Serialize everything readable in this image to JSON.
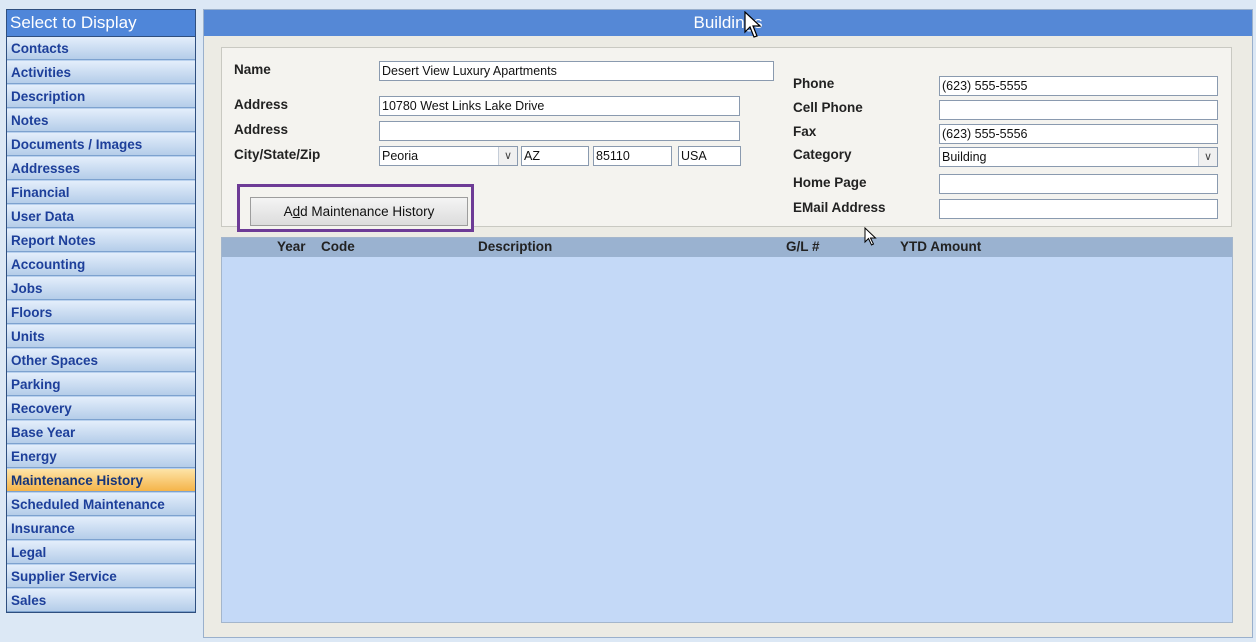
{
  "sidebar": {
    "title": "Select to Display",
    "items": [
      {
        "label": "Contacts"
      },
      {
        "label": "Activities"
      },
      {
        "label": "Description"
      },
      {
        "label": "Notes"
      },
      {
        "label": "Documents / Images"
      },
      {
        "label": "Addresses"
      },
      {
        "label": "Financial"
      },
      {
        "label": "User Data"
      },
      {
        "label": "Report Notes"
      },
      {
        "label": "Accounting"
      },
      {
        "label": "Jobs"
      },
      {
        "label": "Floors"
      },
      {
        "label": "Units"
      },
      {
        "label": "Other Spaces"
      },
      {
        "label": "Parking"
      },
      {
        "label": "Recovery"
      },
      {
        "label": "Base Year"
      },
      {
        "label": "Energy"
      },
      {
        "label": "Maintenance History",
        "active": true
      },
      {
        "label": "Scheduled Maintenance"
      },
      {
        "label": "Insurance"
      },
      {
        "label": "Legal"
      },
      {
        "label": "Supplier Service"
      },
      {
        "label": "Sales"
      }
    ],
    "colors": {
      "active": "#f5b44a",
      "title": "#4f86d9"
    }
  },
  "main": {
    "title": "Buildings",
    "form": {
      "name_label": "Name",
      "name_value": "Desert View Luxury Apartments",
      "address1_label": "Address",
      "address1_value": "10780 West Links Lake Drive",
      "address2_label": "Address",
      "address2_value": "",
      "csz_label": "City/State/Zip",
      "city_value": "Peoria",
      "state_value": "AZ",
      "zip_value": "85110",
      "country_value": "USA",
      "phone_label": "Phone",
      "phone_value": "(623) 555-5555",
      "cell_label": "Cell Phone",
      "cell_value": "",
      "fax_label": "Fax",
      "fax_value": "(623) 555-5556",
      "category_label": "Category",
      "category_value": "Building",
      "homepage_label": "Home Page",
      "homepage_value": "",
      "email_label": "EMail Address",
      "email_value": ""
    },
    "add_button": {
      "label_pre": "A",
      "label_ul": "d",
      "label_post": "d Maintenance History"
    },
    "grid": {
      "columns": [
        "Year",
        "Code",
        "Description",
        "G/L #",
        "YTD Amount"
      ]
    }
  },
  "icons": [
    "mouse-cursor-icon",
    "chevron-down-icon"
  ],
  "colors": {
    "highlight_frame": "#6d3b96",
    "header": "#5588d6"
  }
}
